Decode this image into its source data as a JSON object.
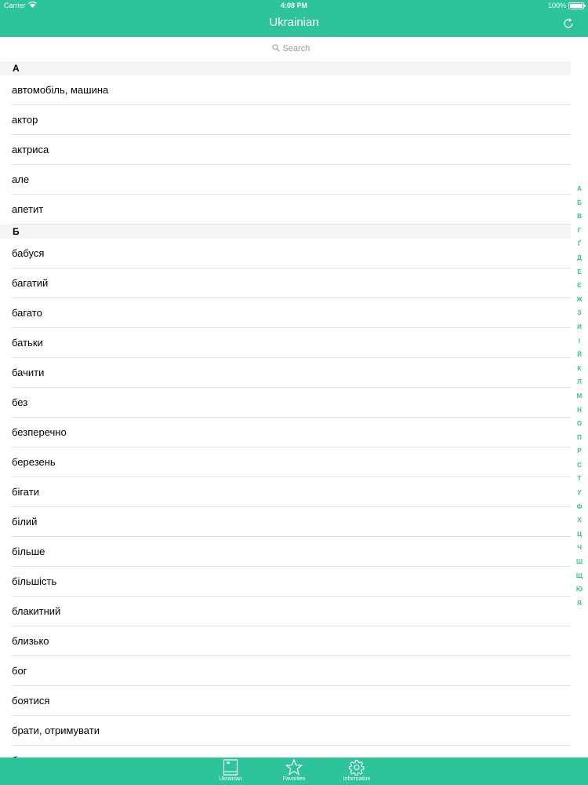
{
  "status": {
    "carrier": "Carrier",
    "time": "4:08 PM",
    "battery": "100%"
  },
  "nav": {
    "title": "Ukrainian"
  },
  "search": {
    "placeholder": "Search"
  },
  "sections": [
    {
      "letter": "А",
      "items": [
        "автомобіль, машина",
        "актор",
        "актриса",
        "але",
        "апетит"
      ]
    },
    {
      "letter": "Б",
      "items": [
        "бабуся",
        "багатий",
        "багато",
        "батьки",
        "бачити",
        "без",
        "безперечно",
        "березень",
        "бігати",
        "білий",
        "більше",
        "більшість",
        "блакитний",
        "близько",
        "бог",
        "боятися",
        "брати, отримувати",
        "брехати"
      ]
    }
  ],
  "index": [
    "А",
    "Б",
    "В",
    "Г",
    "Ґ",
    "Д",
    "Е",
    "Є",
    "Ж",
    "З",
    "И",
    "І",
    "Й",
    "К",
    "Л",
    "М",
    "Н",
    "О",
    "П",
    "Р",
    "С",
    "Т",
    "У",
    "Ф",
    "Х",
    "Ц",
    "Ч",
    "Ш",
    "Щ",
    "Ю",
    "Я"
  ],
  "tabs": [
    {
      "label": "Ukrainian",
      "icon": "book-icon"
    },
    {
      "label": "Favorites",
      "icon": "star-icon"
    },
    {
      "label": "Information",
      "icon": "gear-icon"
    }
  ],
  "colors": {
    "accent": "#2dc499",
    "section_bg": "#f4f4f6",
    "separator": "#e3e3e3",
    "placeholder": "#9b9b9b"
  }
}
